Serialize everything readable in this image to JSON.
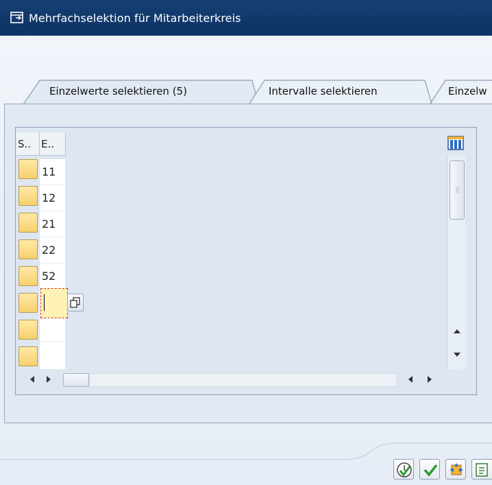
{
  "window": {
    "title": "Mehrfachselektion für Mitarbeiterkreis",
    "title_icon": "dialog-window-icon"
  },
  "tabs": [
    {
      "label": "Einzelwerte selektieren (5)",
      "active": true
    },
    {
      "label": "Intervalle selektieren",
      "active": false
    },
    {
      "label": "Einzelw",
      "active": false
    }
  ],
  "table": {
    "columns": [
      "S..",
      "E.."
    ],
    "rows": [
      {
        "value": "11"
      },
      {
        "value": "12"
      },
      {
        "value": "21"
      },
      {
        "value": "22"
      },
      {
        "value": "52"
      },
      {
        "value": ""
      },
      {
        "value": ""
      },
      {
        "value": ""
      }
    ],
    "column_settings_icon": "column-layout-icon",
    "value_help_icon": "value-help-icon"
  },
  "footer": {
    "buttons": [
      {
        "icon": "execute-check-icon"
      },
      {
        "icon": "confirm-check-icon"
      },
      {
        "icon": "insert-line-icon"
      },
      {
        "icon": "clipboard-import-icon"
      }
    ]
  },
  "colors": {
    "titlebar": "#133a6d",
    "row_selector": "#f7d06d",
    "panel": "#e1e9f3",
    "active_cell_border": "#cc2a2a"
  }
}
